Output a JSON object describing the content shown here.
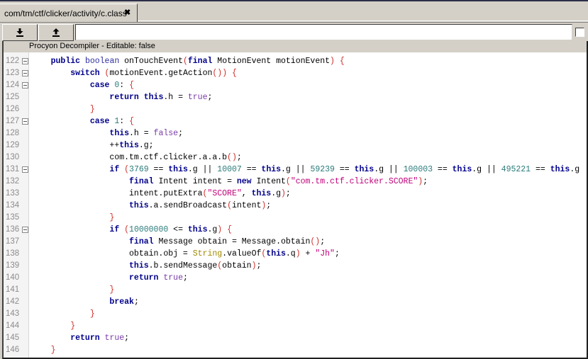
{
  "tab": {
    "title": "com/tm/ctf/clicker/activity/c.class",
    "close_glyph": "✖"
  },
  "toolbar": {
    "download_icon": "download-icon",
    "upload_icon": "upload-icon",
    "search_value": "",
    "checkbox_checked": false
  },
  "editor": {
    "header": "Procyon Decompiler - Editable: false",
    "lines": [
      {
        "n": "122",
        "fold": true,
        "code": "    public boolean onTouchEvent(final MotionEvent motionEvent) {"
      },
      {
        "n": "123",
        "fold": true,
        "code": "        switch (motionEvent.getAction()) {"
      },
      {
        "n": "124",
        "fold": true,
        "code": "            case 0: {"
      },
      {
        "n": "125",
        "fold": false,
        "code": "                return this.h = true;"
      },
      {
        "n": "126",
        "fold": false,
        "code": "            }"
      },
      {
        "n": "127",
        "fold": true,
        "code": "            case 1: {"
      },
      {
        "n": "128",
        "fold": false,
        "code": "                this.h = false;"
      },
      {
        "n": "129",
        "fold": false,
        "code": "                ++this.g;"
      },
      {
        "n": "130",
        "fold": false,
        "code": "                com.tm.ctf.clicker.a.a.b();"
      },
      {
        "n": "131",
        "fold": true,
        "code": "                if (3769 == this.g || 10007 == this.g || 59239 == this.g || 100003 == this.g || 495221 == this.g"
      },
      {
        "n": "132",
        "fold": false,
        "code": "                    final Intent intent = new Intent(\"com.tm.ctf.clicker.SCORE\");"
      },
      {
        "n": "133",
        "fold": false,
        "code": "                    intent.putExtra(\"SCORE\", this.g);"
      },
      {
        "n": "134",
        "fold": false,
        "code": "                    this.a.sendBroadcast(intent);"
      },
      {
        "n": "135",
        "fold": false,
        "code": "                }"
      },
      {
        "n": "136",
        "fold": true,
        "code": "                if (10000000 <= this.g) {"
      },
      {
        "n": "137",
        "fold": false,
        "code": "                    final Message obtain = Message.obtain();"
      },
      {
        "n": "138",
        "fold": false,
        "code": "                    obtain.obj = String.valueOf(this.q) + \"Jh\";"
      },
      {
        "n": "139",
        "fold": false,
        "code": "                    this.b.sendMessage(obtain);"
      },
      {
        "n": "140",
        "fold": false,
        "code": "                    return true;"
      },
      {
        "n": "141",
        "fold": false,
        "code": "                }"
      },
      {
        "n": "142",
        "fold": false,
        "code": "                break;"
      },
      {
        "n": "143",
        "fold": false,
        "code": "            }"
      },
      {
        "n": "144",
        "fold": false,
        "code": "        }"
      },
      {
        "n": "145",
        "fold": false,
        "code": "        return true;"
      },
      {
        "n": "146",
        "fold": false,
        "code": "    }"
      }
    ]
  }
}
